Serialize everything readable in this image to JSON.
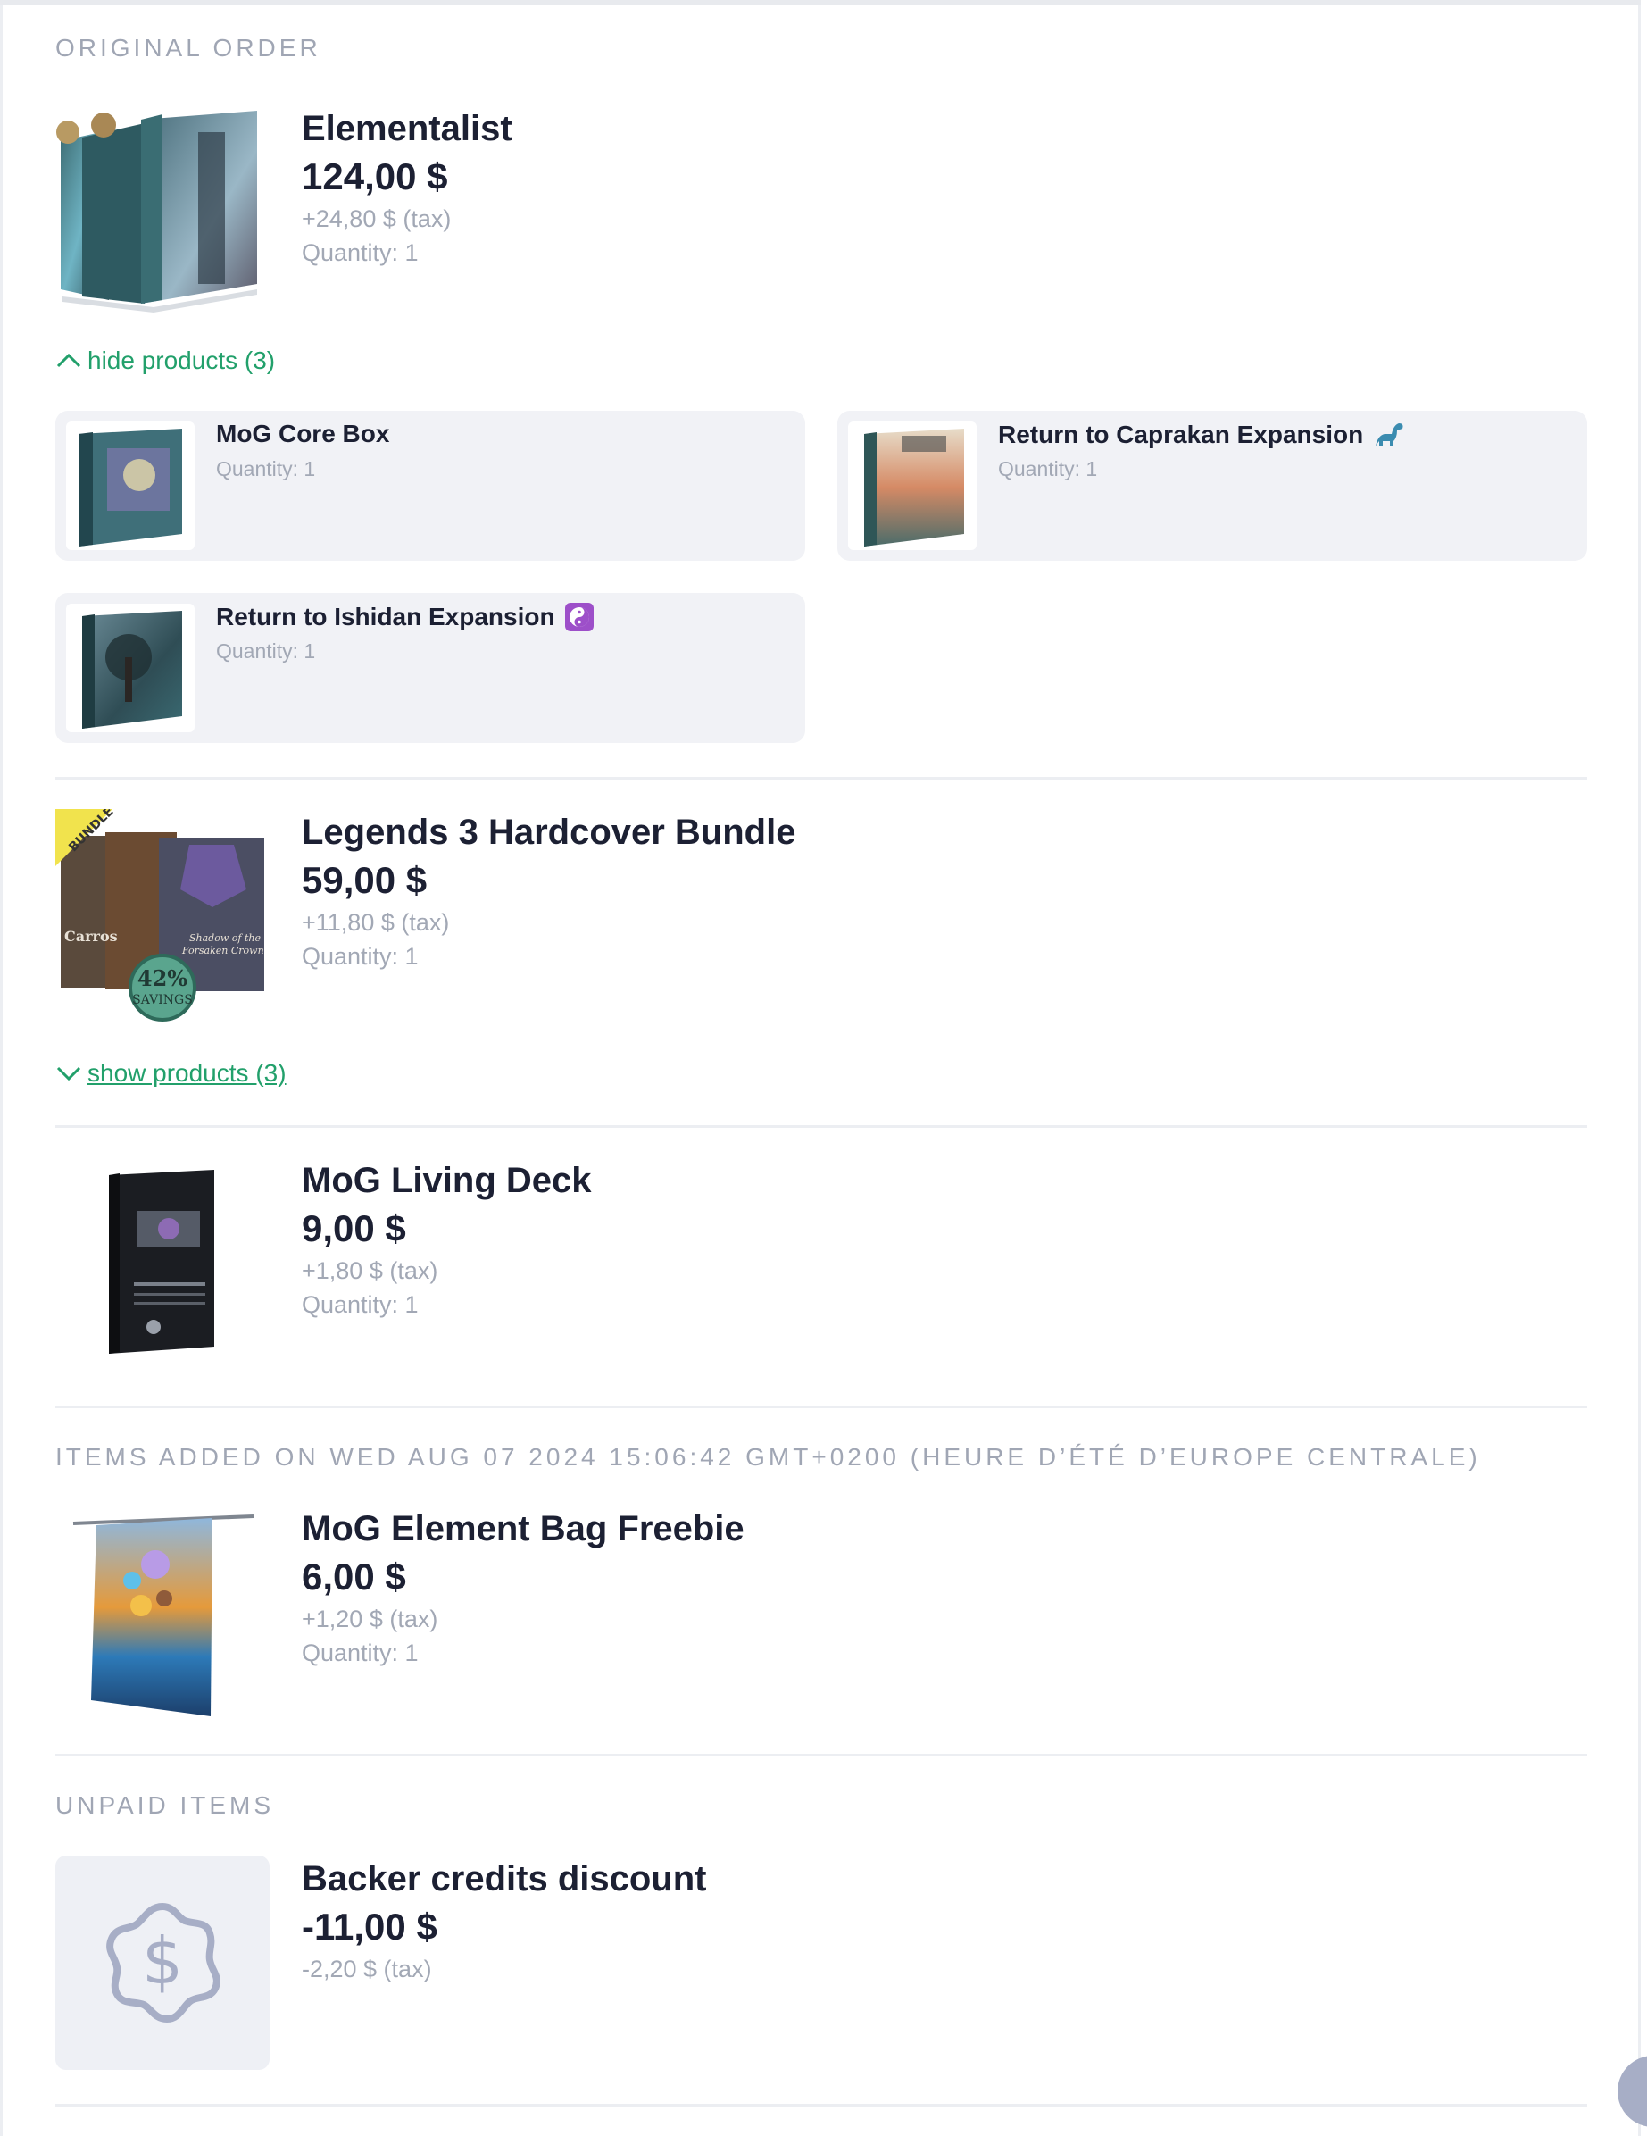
{
  "sections": {
    "original_order": "ORIGINAL ORDER",
    "items_added": "ITEMS ADDED ON WED AUG 07 2024 15:06:42 GMT+0200 (HEURE D’ÉTÉ D’EUROPE CENTRALE)",
    "unpaid_items": "UNPAID ITEMS"
  },
  "elementalist": {
    "title": "Elementalist",
    "price": "124,00 $",
    "tax": "+24,80 $ (tax)",
    "quantity": "Quantity: 1",
    "toggle": "hide products (3)",
    "products": [
      {
        "name": "MoG Core Box",
        "quantity": "Quantity: 1"
      },
      {
        "name": "Return to Caprakan Expansion",
        "quantity": "Quantity: 1",
        "icon": "dinosaur-emoji"
      },
      {
        "name": "Return to Ishidan Expansion",
        "quantity": "Quantity: 1",
        "icon": "yin-yang-emoji"
      }
    ]
  },
  "legends": {
    "title": "Legends 3 Hardcover Bundle",
    "price": "59,00 $",
    "tax": "+11,80 $ (tax)",
    "quantity": "Quantity: 1",
    "toggle": "show products (3)",
    "badge_ribbon": "BUNDLE",
    "badge_savings_pct": "42%",
    "badge_savings_word": "SAVINGS",
    "cover_left": "Carros",
    "cover_right": "Shadow of the Forsaken Crown"
  },
  "living_deck": {
    "title": "MoG Living Deck",
    "price": "9,00 $",
    "tax": "+1,80 $ (tax)",
    "quantity": "Quantity: 1"
  },
  "element_bag": {
    "title": "MoG Element Bag Freebie",
    "price": "6,00 $",
    "tax": "+1,20 $ (tax)",
    "quantity": "Quantity: 1"
  },
  "backer_credits": {
    "title": "Backer credits discount",
    "price": "-11,00 $",
    "tax": "-2,20 $ (tax)",
    "icon": "dollar-badge-icon"
  },
  "colors": {
    "accent_green": "#22a06b",
    "muted_text": "#a2a8b5",
    "card_bg": "#f1f2f6"
  }
}
